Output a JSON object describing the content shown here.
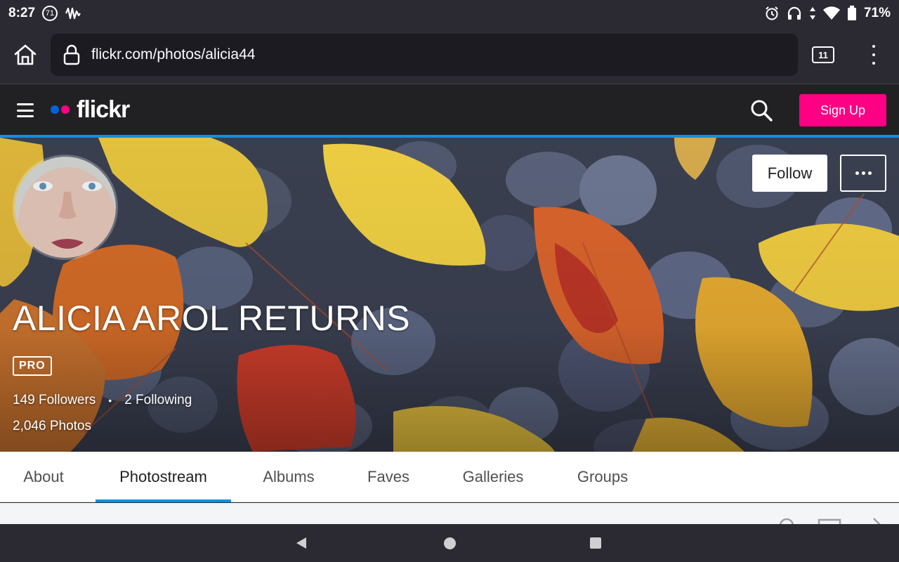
{
  "status_bar": {
    "time": "8:27",
    "notification_count": "71",
    "battery_percent": "71%",
    "icons": [
      "notification-count-icon",
      "audio-wave-icon",
      "alarm-icon",
      "headphones-icon",
      "data-arrows-icon",
      "wifi-icon",
      "battery-icon"
    ]
  },
  "browser": {
    "url": "flickr.com/photos/alicia44",
    "tab_count": "11",
    "icons": [
      "home-icon",
      "lock-icon",
      "tabs-icon",
      "overflow-menu-icon"
    ]
  },
  "header": {
    "logo_text": "flickr",
    "signup_label": "Sign Up",
    "logo_colors": {
      "blue": "#0063dc",
      "pink": "#ff0084"
    },
    "icons": [
      "hamburger-menu-icon",
      "search-icon"
    ]
  },
  "profile": {
    "name": "ALICIA AROL RETURNS",
    "badge": "PRO",
    "followers": "149 Followers",
    "separator": "•",
    "following": "2 Following",
    "photos": "2,046 Photos",
    "follow_label": "Follow",
    "icons": [
      "more-options-icon"
    ]
  },
  "tabs": [
    {
      "label": "About",
      "active": false
    },
    {
      "label": "Photostream",
      "active": true
    },
    {
      "label": "Albums",
      "active": false
    },
    {
      "label": "Faves",
      "active": false
    },
    {
      "label": "Galleries",
      "active": false
    },
    {
      "label": "Groups",
      "active": false
    }
  ],
  "colors": {
    "accent_blue": "#128fdc",
    "signup_pink": "#ff0084",
    "header_bg": "#212124"
  }
}
